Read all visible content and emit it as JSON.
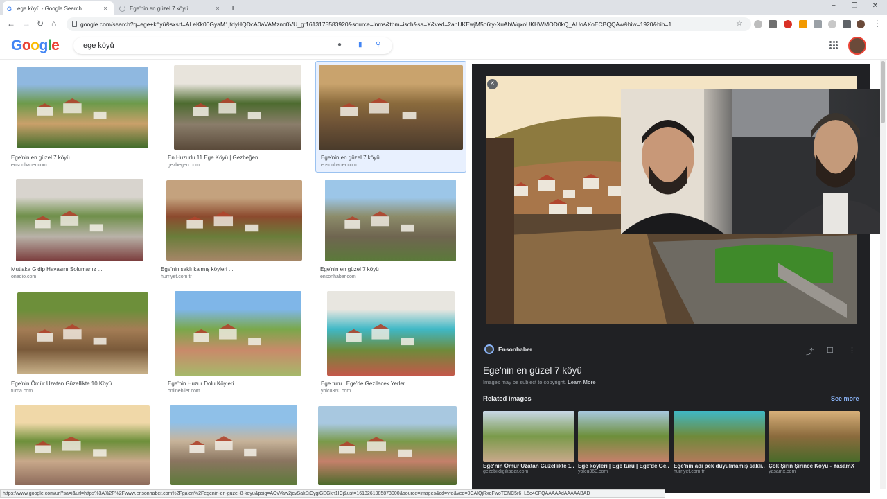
{
  "browser": {
    "tabs": [
      {
        "title": "ege köyü - Google Search",
        "active": true
      },
      {
        "title": "Ege'nin en güzel 7 köyü",
        "active": false
      }
    ],
    "new_tab_label": "+",
    "close_label": "×",
    "window_controls": [
      "−",
      "❐",
      "✕"
    ],
    "url": "google.com/search?q=ege+köyü&sxsrf=ALeKk00GyaM1jfdyHQDcA0aVAMzno0VU_g:1613175583920&source=lnms&tbm=isch&sa=X&ved=2ahUKEwjM5o6ty-XuAhWqxoUKHWMOD0kQ_AUoAXoECBQQAw&biw=1920&bih=1...",
    "status_url": "https://www.google.com/url?sa=i&url=https%3A%2F%2Fwww.ensonhaber.com%2Fgaleri%2Fegenin-en-guzel-8-koyu&psig=AOvVaw2jcvSakSiCygiGEGkn1ICj&ust=1613261985873000&source=images&cd=vfe&ved=0CAIQjRxqFwoTCNC5r6_L5e4CFQAAAAAdAAAAABAD"
  },
  "google": {
    "logo_letters": [
      {
        "ch": "G",
        "color": "#4285f4"
      },
      {
        "ch": "o",
        "color": "#ea4335"
      },
      {
        "ch": "o",
        "color": "#fbbc05"
      },
      {
        "ch": "g",
        "color": "#4285f4"
      },
      {
        "ch": "l",
        "color": "#34a853"
      },
      {
        "ch": "e",
        "color": "#ea4335"
      }
    ],
    "query": "ege köyü"
  },
  "results": [
    {
      "title": "Ege'nin en güzel 7 köyü",
      "source": "ensonhaber.com",
      "palette": [
        "#8fb8e0",
        "#6d9a4a",
        "#c9a06a",
        "#3e6b2a"
      ]
    },
    {
      "title": "En Huzurlu 11 Ege Köyü | Gezbeğen",
      "source": "gezbegen.com",
      "palette": [
        "#e8e4dc",
        "#4d6b2f",
        "#8a7d6a",
        "#5a4a3a"
      ]
    },
    {
      "title": "Ege'nin en güzel 7 köyü",
      "source": "ensonhaber.com",
      "palette": [
        "#c9a36d",
        "#8b6b3d",
        "#6d5236",
        "#4a3b2b"
      ]
    },
    {
      "title": "Mutlaka Gidip Havasını Solumanız ...",
      "source": "onedio.com",
      "palette": [
        "#d8d4ce",
        "#6f8f4a",
        "#b9b2a8",
        "#7a3b3b"
      ]
    },
    {
      "title": "Ege'nin saklı kalmış köyleri ...",
      "source": "hurriyet.com.tr",
      "palette": [
        "#c4a27e",
        "#8c4a2e",
        "#6a7d3a",
        "#a58667"
      ]
    },
    {
      "title": "Ege'nin en güzel 7 köyü",
      "source": "ensonhaber.com",
      "palette": [
        "#9cc6e8",
        "#8c8c6a",
        "#6f6550",
        "#5b7a3a"
      ]
    },
    {
      "title": "Ege'nin Ömür Uzatan Güzellikte 10 Köyü ...",
      "source": "turna.com",
      "palette": [
        "#6d8f3a",
        "#a47d55",
        "#7a5a3a",
        "#c9b28a"
      ]
    },
    {
      "title": "Ege'nin Huzur Dolu Köyleri",
      "source": "onlinebilet.com",
      "palette": [
        "#7fb6e8",
        "#7aa84a",
        "#c98a6a",
        "#a6b86a"
      ]
    },
    {
      "title": "Ege turu | Ege'de Gezilecek Yerler ...",
      "source": "yolcu360.com",
      "palette": [
        "#e8e6e0",
        "#3fb8c6",
        "#6f8a3a",
        "#c4584a"
      ]
    },
    {
      "title": "",
      "source": "",
      "palette": [
        "#f0d8a8",
        "#6d8f3a",
        "#c8a88a",
        "#8c6a5a"
      ]
    },
    {
      "title": "",
      "source": "",
      "palette": [
        "#8fc0e8",
        "#c8b49a",
        "#8a7560",
        "#5d7a3a"
      ]
    },
    {
      "title": "",
      "source": "",
      "palette": [
        "#a8c8e0",
        "#7a9a4a",
        "#c4806a",
        "#4a6a2a"
      ]
    }
  ],
  "panel": {
    "close_label": "×",
    "source_name": "Ensonhaber",
    "title": "Ege'nin en güzel 7 köyü",
    "copyright_text": "Images may be subject to copyright.",
    "learn_more": "Learn More",
    "related_heading": "Related images",
    "see_more": "See more",
    "related": [
      {
        "title": "Ege'nin Ömür Uzatan Güzellikte 1...",
        "source": "gezebildigikadar.com",
        "palette": [
          "#c9d8e8",
          "#7a9a4a",
          "#c8a88a"
        ]
      },
      {
        "title": "Ege köyleri | Ege turu | Ege'de Ge...",
        "source": "yolcu360.com",
        "palette": [
          "#a8c8e0",
          "#6d8f3a",
          "#c4806a"
        ]
      },
      {
        "title": "Ege'nin adı pek duyulmamış saklı...",
        "source": "hurriyet.com.tr",
        "palette": [
          "#3fb8c6",
          "#6f8a3a",
          "#b07a5a"
        ]
      },
      {
        "title": "Çok Şirin Şirince Köyü - YasamX",
        "source": "yasamx.com",
        "palette": [
          "#d8b07a",
          "#8b6b3d",
          "#4a6a2a"
        ]
      }
    ]
  },
  "colors": {
    "accent": "#1a73e8",
    "panel_bg": "#202124",
    "link_dark": "#8ab4f8"
  }
}
